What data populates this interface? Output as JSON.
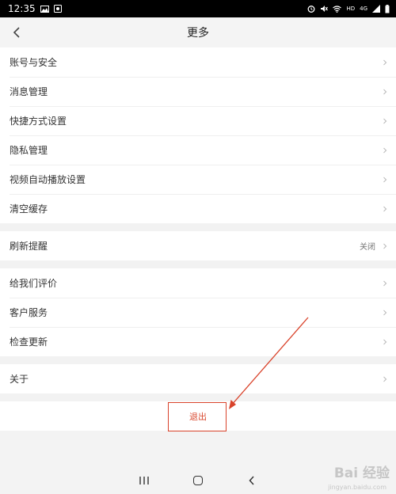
{
  "status_bar": {
    "time": "12:35",
    "left_icons": [
      "image-icon",
      "notification-icon"
    ],
    "right_icons": [
      "alarm-icon",
      "mute-icon",
      "wifi-icon",
      "hd-icon",
      "signal-icon",
      "battery-icon"
    ],
    "network_label": "4G",
    "hd_label": "HD"
  },
  "nav": {
    "title": "更多"
  },
  "groups": [
    {
      "items": [
        {
          "label": "账号与安全"
        },
        {
          "label": "消息管理"
        },
        {
          "label": "快捷方式设置"
        },
        {
          "label": "隐私管理"
        },
        {
          "label": "视频自动播放设置"
        },
        {
          "label": "清空缓存"
        }
      ]
    },
    {
      "items": [
        {
          "label": "刷新提醒",
          "value": "关闭"
        }
      ]
    },
    {
      "items": [
        {
          "label": "给我们评价"
        },
        {
          "label": "客户服务"
        },
        {
          "label": "检查更新"
        }
      ]
    },
    {
      "items": [
        {
          "label": "关于"
        }
      ]
    }
  ],
  "logout": {
    "label": "退出"
  },
  "annotation": {
    "color": "#d9432b"
  },
  "watermark": {
    "text": "Bai 经验",
    "subtext": "jingyan.baidu.com"
  },
  "colors": {
    "accent": "#d94a30",
    "background": "#f3f3f3"
  }
}
